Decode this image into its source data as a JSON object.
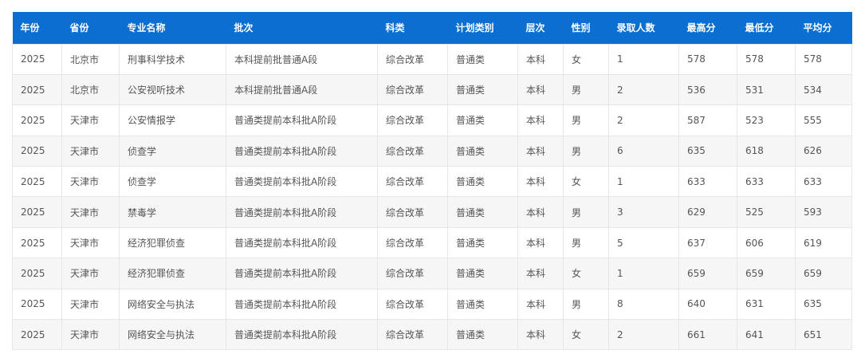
{
  "colors": {
    "header_bg": "#0a6fd0",
    "header_text": "#ffffff",
    "cell_text": "#555555",
    "row_alt_bg": "#f6f6f6",
    "border": "#e6e6e6"
  },
  "table": {
    "headers": [
      "年份",
      "省份",
      "专业名称",
      "批次",
      "科类",
      "计划类别",
      "层次",
      "性别",
      "录取人数",
      "最高分",
      "最低分",
      "平均分"
    ],
    "rows": [
      [
        "2025",
        "北京市",
        "刑事科学技术",
        "本科提前批普通A段",
        "综合改革",
        "普通类",
        "本科",
        "女",
        "1",
        "578",
        "578",
        "578"
      ],
      [
        "2025",
        "北京市",
        "公安视听技术",
        "本科提前批普通A段",
        "综合改革",
        "普通类",
        "本科",
        "男",
        "2",
        "536",
        "531",
        "534"
      ],
      [
        "2025",
        "天津市",
        "公安情报学",
        "普通类提前本科批A阶段",
        "综合改革",
        "普通类",
        "本科",
        "男",
        "2",
        "587",
        "523",
        "555"
      ],
      [
        "2025",
        "天津市",
        "侦查学",
        "普通类提前本科批A阶段",
        "综合改革",
        "普通类",
        "本科",
        "男",
        "6",
        "635",
        "618",
        "626"
      ],
      [
        "2025",
        "天津市",
        "侦查学",
        "普通类提前本科批A阶段",
        "综合改革",
        "普通类",
        "本科",
        "女",
        "1",
        "633",
        "633",
        "633"
      ],
      [
        "2025",
        "天津市",
        "禁毒学",
        "普通类提前本科批A阶段",
        "综合改革",
        "普通类",
        "本科",
        "男",
        "3",
        "629",
        "525",
        "593"
      ],
      [
        "2025",
        "天津市",
        "经济犯罪侦查",
        "普通类提前本科批A阶段",
        "综合改革",
        "普通类",
        "本科",
        "男",
        "5",
        "637",
        "606",
        "619"
      ],
      [
        "2025",
        "天津市",
        "经济犯罪侦查",
        "普通类提前本科批A阶段",
        "综合改革",
        "普通类",
        "本科",
        "女",
        "1",
        "659",
        "659",
        "659"
      ],
      [
        "2025",
        "天津市",
        "网络安全与执法",
        "普通类提前本科批A阶段",
        "综合改革",
        "普通类",
        "本科",
        "男",
        "8",
        "640",
        "631",
        "635"
      ],
      [
        "2025",
        "天津市",
        "网络安全与执法",
        "普通类提前本科批A阶段",
        "综合改革",
        "普通类",
        "本科",
        "女",
        "2",
        "661",
        "641",
        "651"
      ]
    ]
  }
}
